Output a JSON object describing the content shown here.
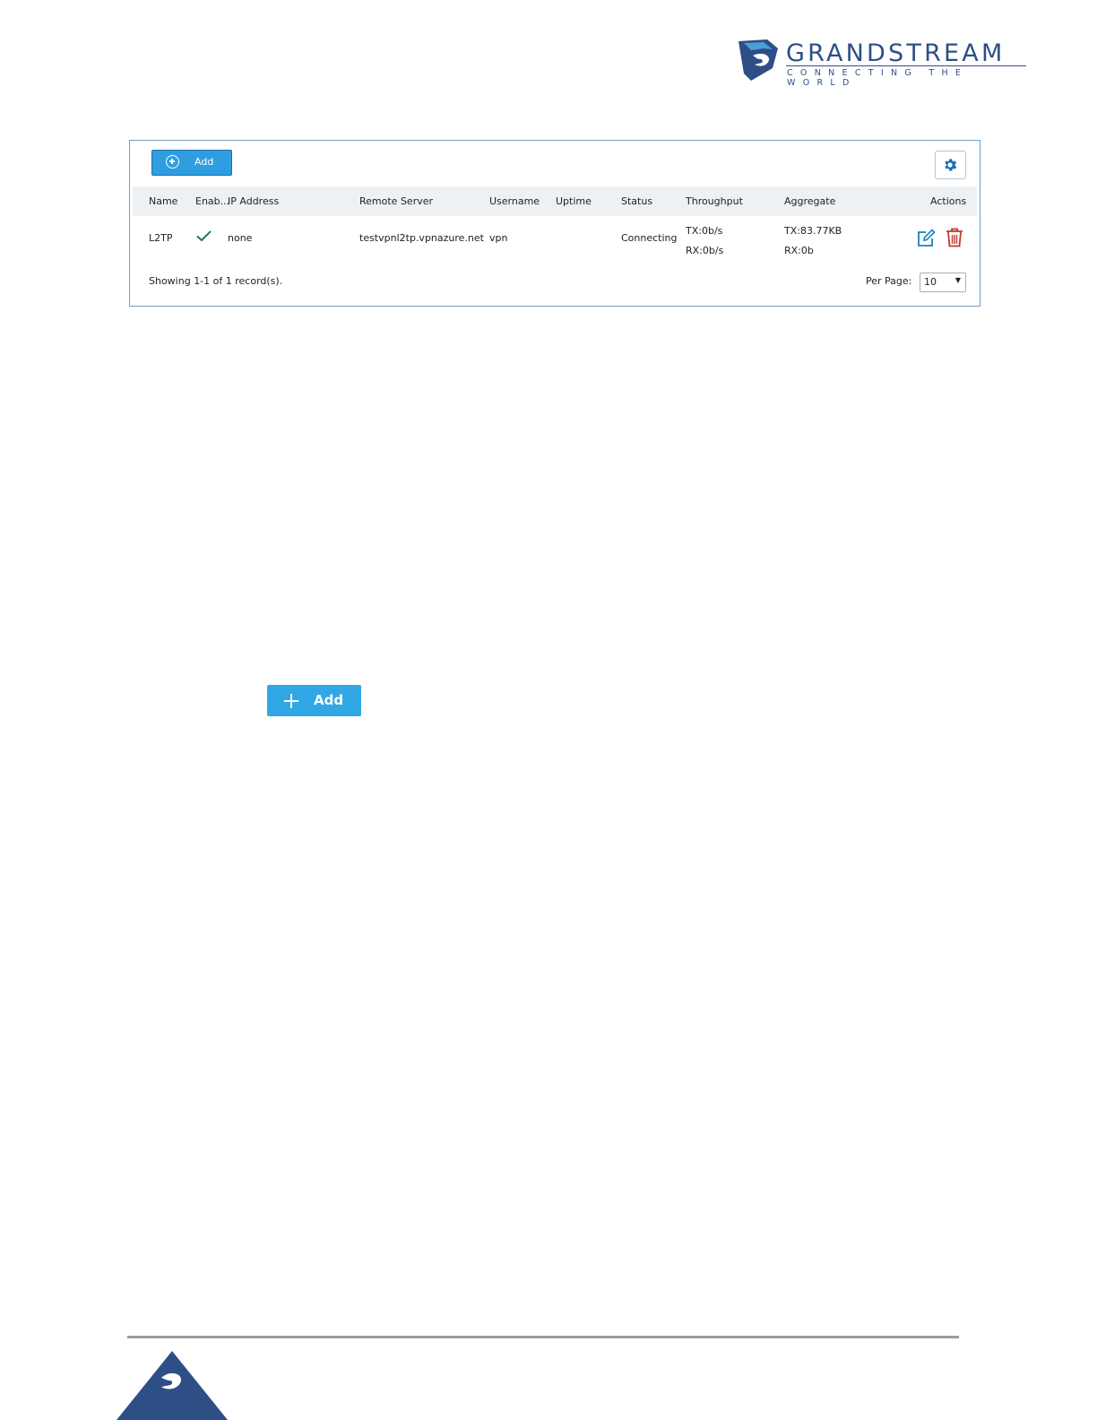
{
  "brand": {
    "name": "GRANDSTREAM",
    "tagline": "CONNECTING THE WORLD",
    "color": "#2d4f86"
  },
  "toolbar": {
    "add_label": "Add",
    "settings_icon": "gear-icon"
  },
  "table": {
    "columns": [
      "Name",
      "Enab...",
      "IP Address",
      "Remote Server",
      "Username",
      "Uptime",
      "Status",
      "Throughput",
      "Aggregate",
      "Actions"
    ],
    "rows": [
      {
        "name": "L2TP",
        "enabled": "check-icon",
        "ip_address": "none",
        "remote_server": "testvpnl2tp.vpnazure.net",
        "username": "vpn",
        "uptime": "",
        "status": "Connecting",
        "throughput_tx": "TX:0b/s",
        "throughput_rx": "RX:0b/s",
        "aggregate_tx": "TX:83.77KB",
        "aggregate_rx": "RX:0b",
        "actions": [
          "edit-icon",
          "trash-icon"
        ]
      }
    ]
  },
  "pagination": {
    "summary": "Showing 1-1 of 1 record(s).",
    "per_page_label": "Per Page:",
    "per_page_value": "10"
  },
  "standalone_button": {
    "label": "Add"
  },
  "colors": {
    "accent": "#2e9ee0",
    "panel_border": "#6f9fc6",
    "delete": "#c0392b",
    "edit": "#1a7fc1",
    "check": "#1f7a52"
  }
}
